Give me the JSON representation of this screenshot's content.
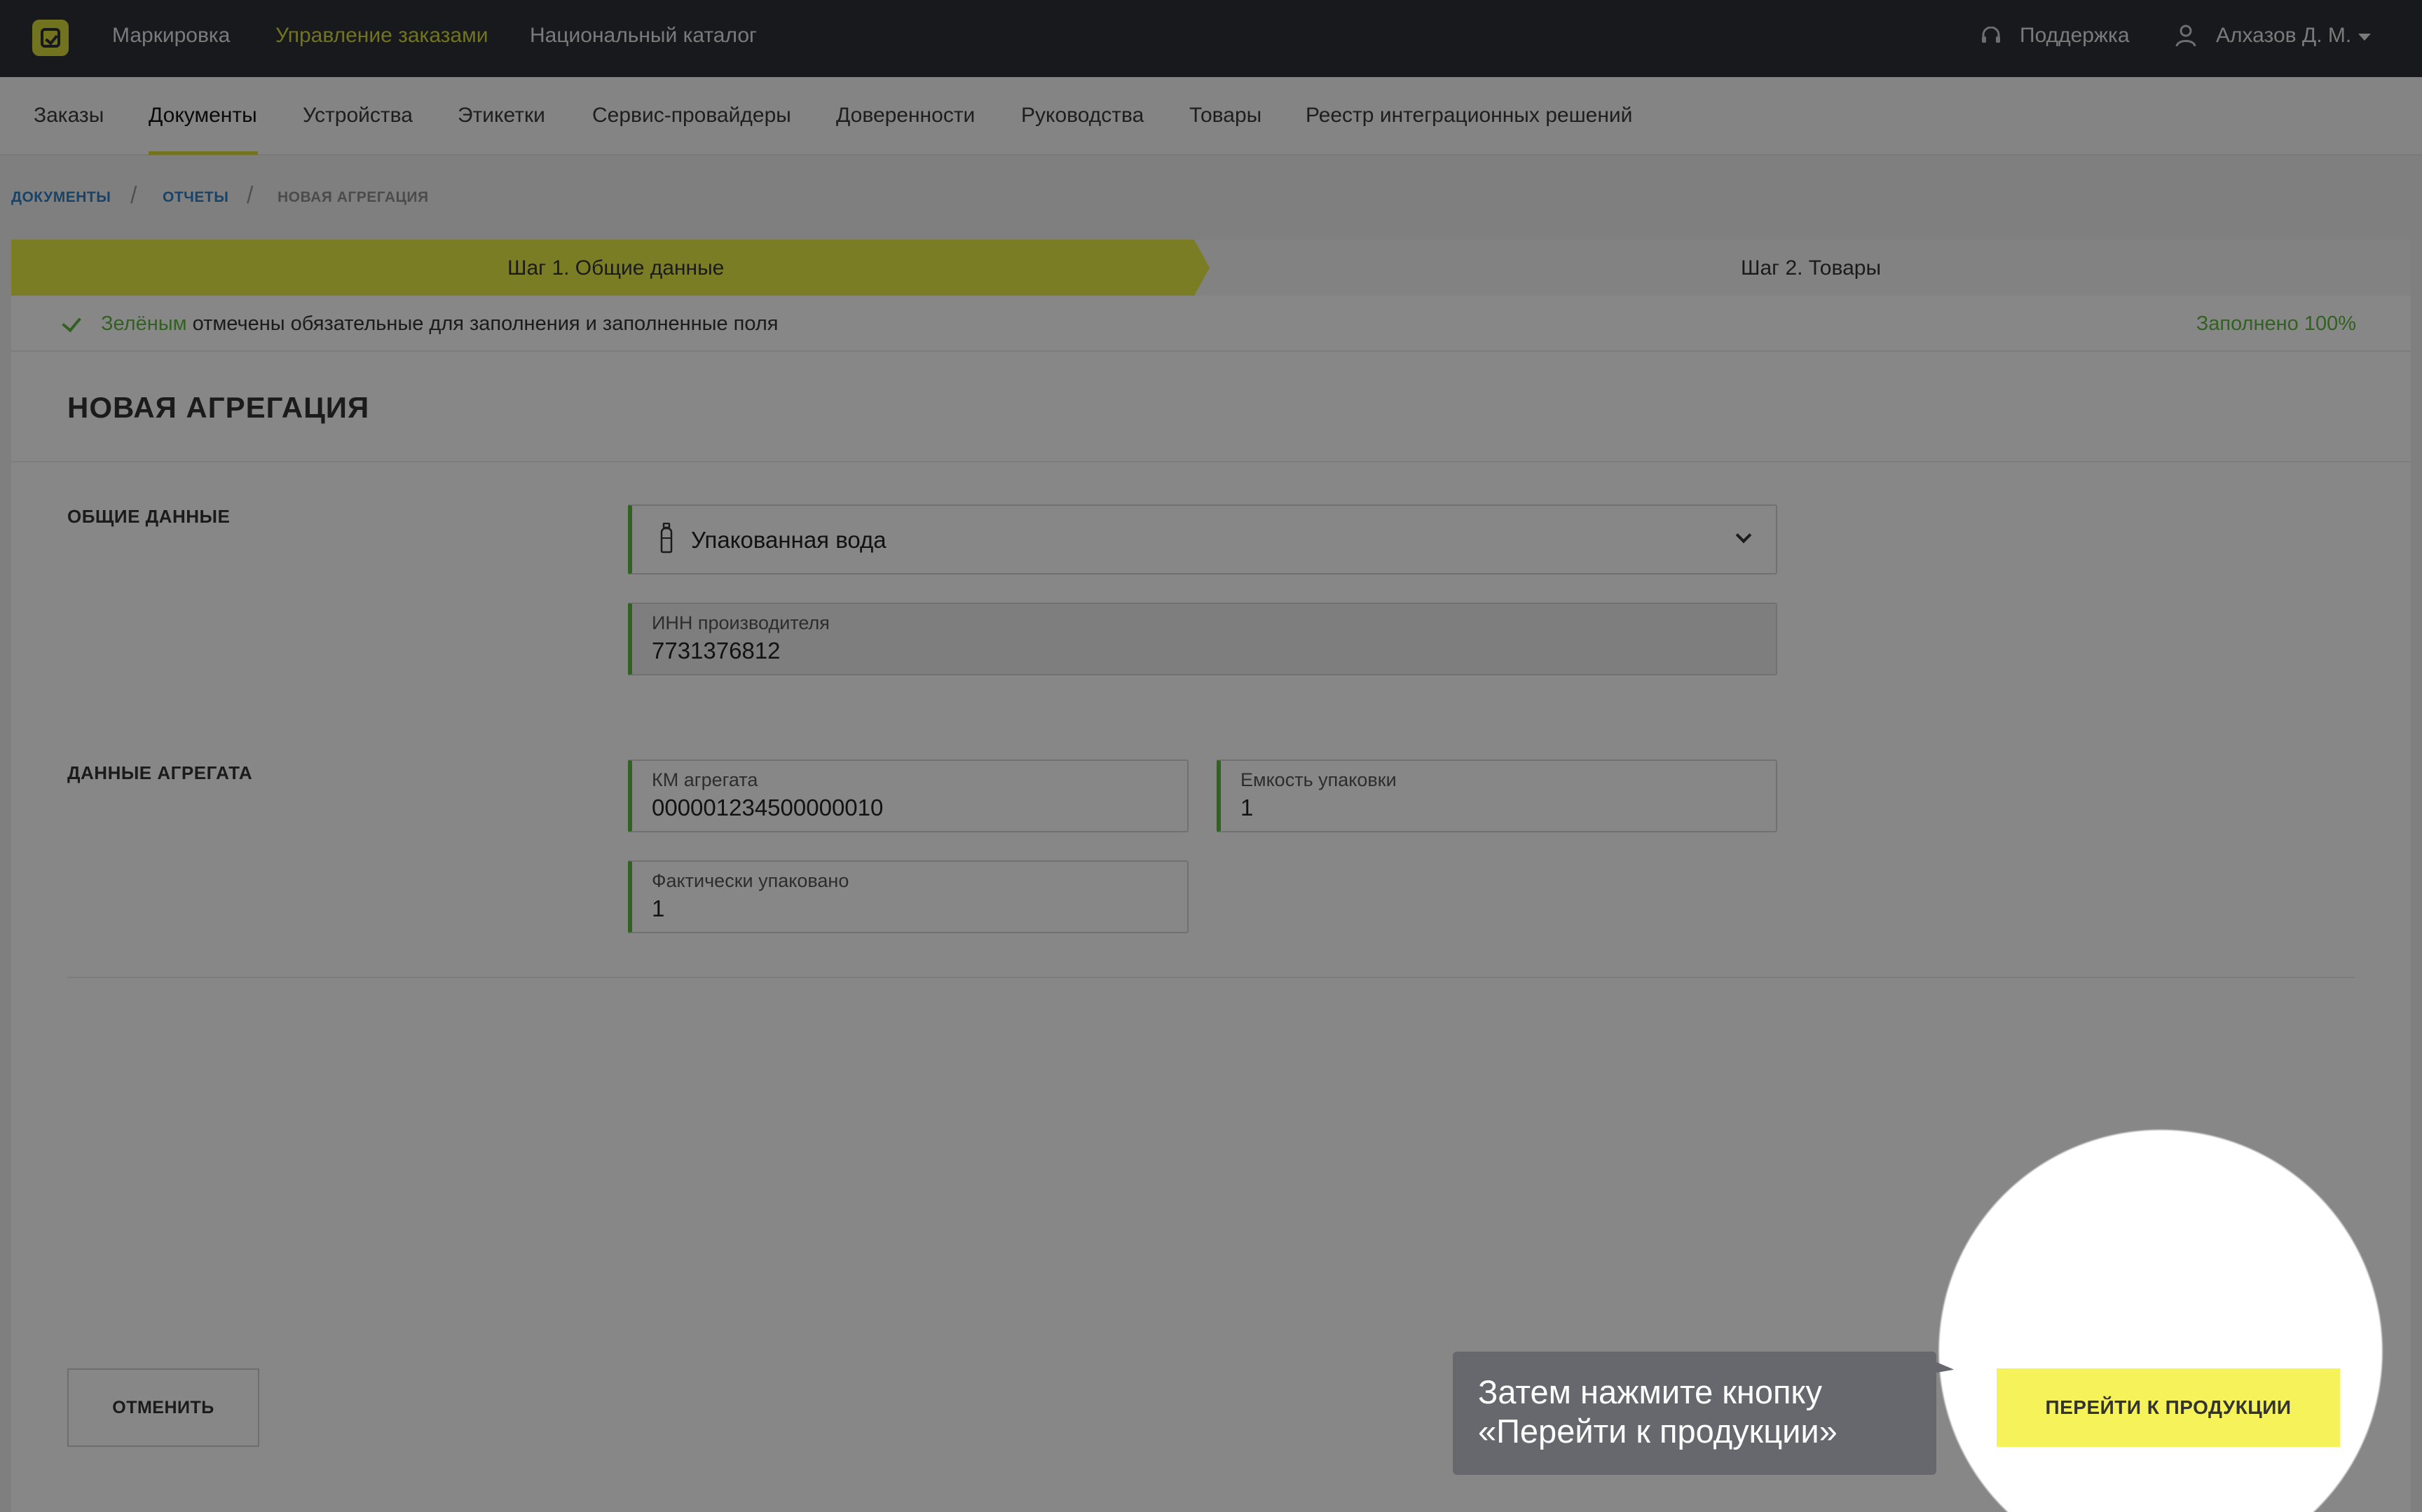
{
  "header": {
    "nav": [
      "Маркировка",
      "Управление заказами",
      "Национальный каталог"
    ],
    "active_nav": "Управление заказами",
    "support_label": "Поддержка",
    "user_label": "Алхазов Д. М."
  },
  "subnav": {
    "items": [
      "Заказы",
      "Документы",
      "Устройства",
      "Этикетки",
      "Сервис-провайдеры",
      "Доверенности",
      "Руководства",
      "Товары",
      "Реестр интеграционных решений"
    ],
    "active": "Документы"
  },
  "breadcrumbs": [
    "Документы",
    "Отчеты",
    "Новая агрегация"
  ],
  "steps": [
    "Шаг 1. Общие данные",
    "Шаг 2. Товары"
  ],
  "notice": {
    "green_word": "Зелёным",
    "rest": " отмечены обязательные для заполнения и заполненные поля",
    "filled": "Заполнено 100%"
  },
  "form": {
    "title": "НОВАЯ АГРЕГАЦИЯ",
    "section_general": "ОБЩИЕ ДАННЫЕ",
    "product_group": "Упакованная вода",
    "inn_label": "ИНН производителя",
    "inn_value": "7731376812",
    "section_aggregate": "ДАННЫЕ АГРЕГАТА",
    "km_label": "КМ агрегата",
    "km_value": "000001234500000010",
    "capacity_label": "Емкость упаковки",
    "capacity_value": "1",
    "packed_label": "Фактически упаковано",
    "packed_value": "1"
  },
  "buttons": {
    "cancel": "ОТМЕНИТЬ",
    "go_to_products": "ПЕРЕЙТИ К ПРОДУКЦИИ"
  },
  "tooltip": {
    "line1": "Затем нажмите кнопку",
    "line2": "«Перейти к продукции»"
  },
  "colors": {
    "accent_yellow": "#e8ec45",
    "button_yellow": "#f5f25a",
    "green": "#5fb840",
    "link_blue": "#2f7fc7",
    "topbar": "#2e3038"
  }
}
